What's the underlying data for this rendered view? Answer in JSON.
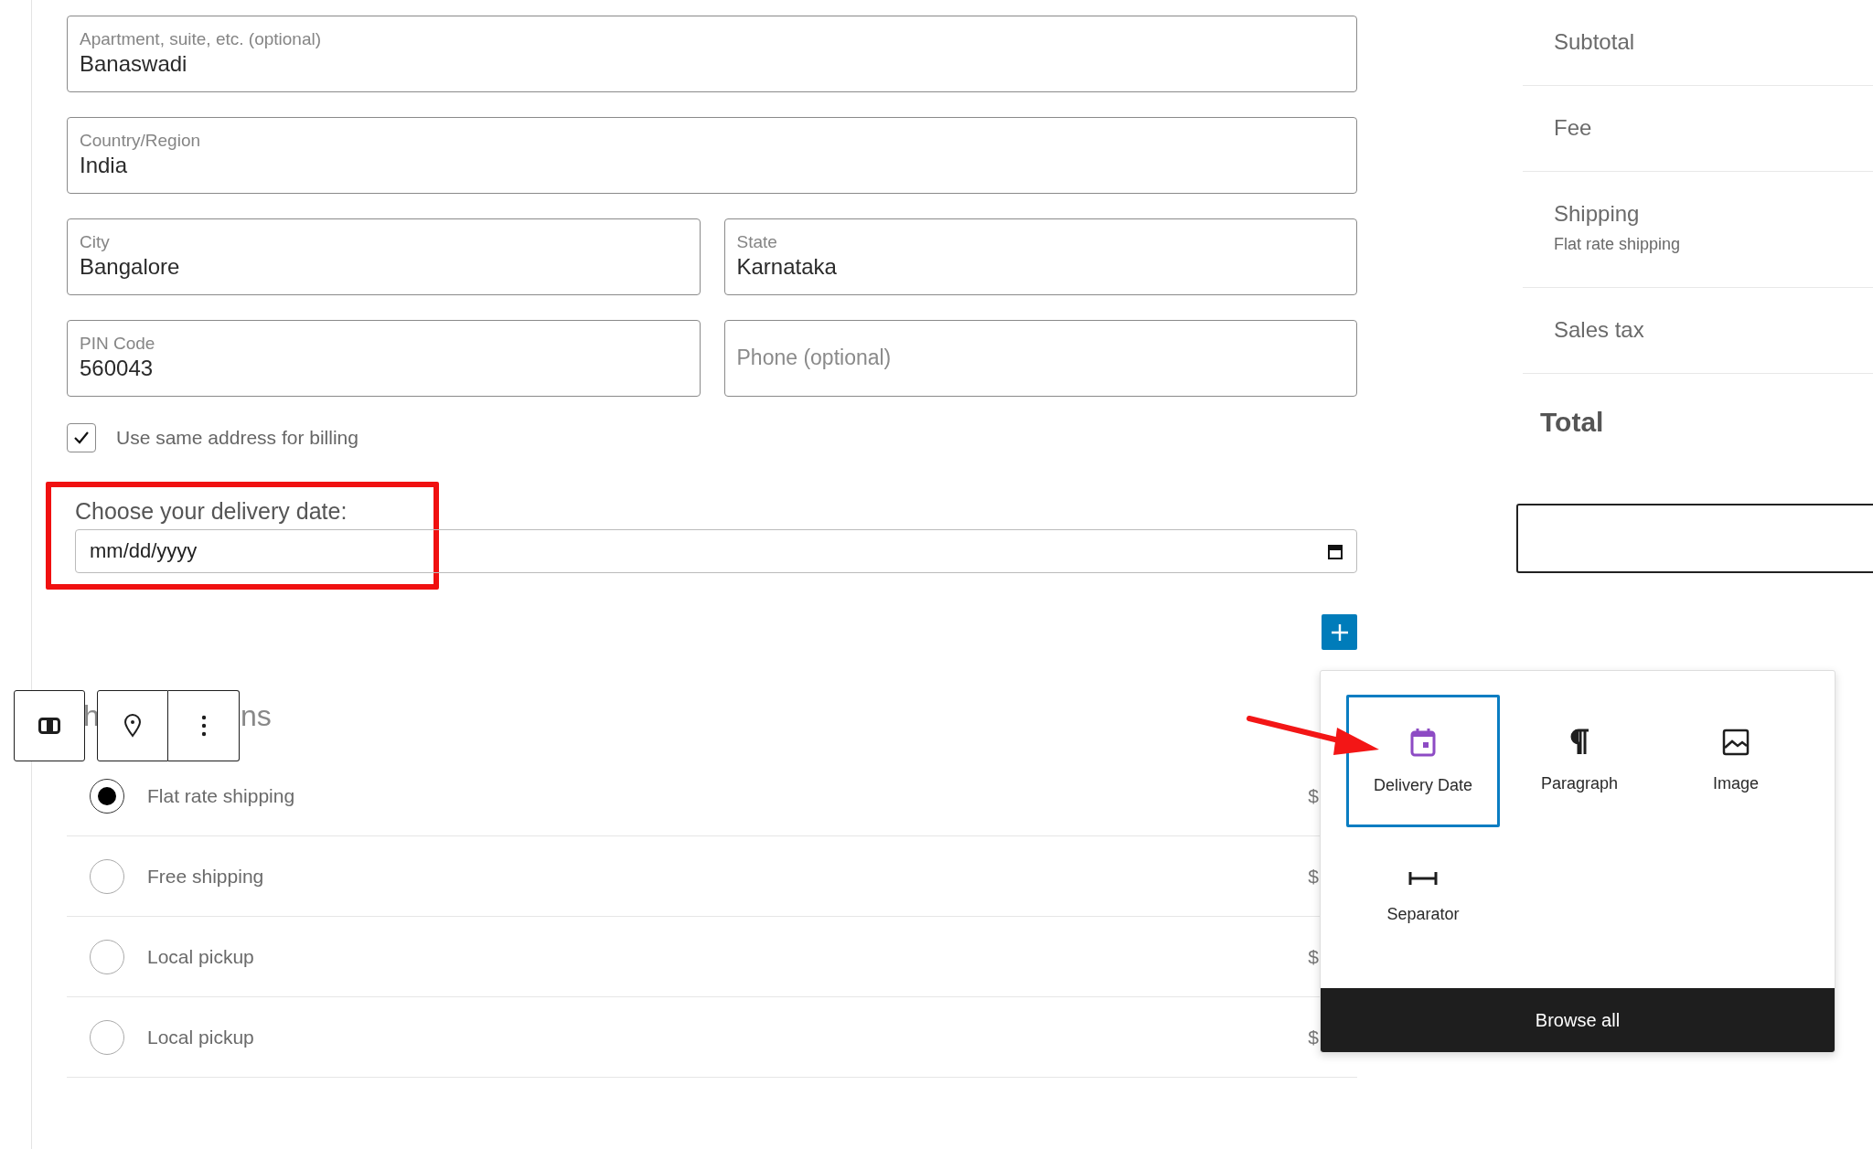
{
  "address_fields": [
    {
      "kind": "full",
      "label": "Apartment, suite, etc. (optional)",
      "value": "Banaswadi"
    },
    {
      "kind": "full",
      "label": "Country/Region",
      "value": "India"
    },
    {
      "kind": "half",
      "label": "City",
      "value": "Bangalore"
    },
    {
      "kind": "half",
      "label": "State",
      "value": "Karnataka"
    },
    {
      "kind": "half",
      "label": "PIN Code",
      "value": "560043"
    },
    {
      "kind": "half",
      "placeholder": "Phone (optional)"
    }
  ],
  "billing_checkbox": {
    "label": "Use same address for billing",
    "checked": true
  },
  "delivery_date": {
    "label": "Choose your delivery date:",
    "placeholder": "mm/dd/yyyy"
  },
  "shipping_heading_fragments": [
    "h",
    "ns"
  ],
  "shipping_options": [
    {
      "label": "Flat rate shipping",
      "selected": true,
      "price": "$"
    },
    {
      "label": "Free shipping",
      "selected": false,
      "price": "$"
    },
    {
      "label": "Local pickup",
      "selected": false,
      "price": "$"
    },
    {
      "label": "Local pickup",
      "selected": false,
      "price": "$"
    }
  ],
  "inserter": {
    "items": [
      {
        "label": "Delivery Date",
        "kind": "calendar",
        "selected": true
      },
      {
        "label": "Paragraph",
        "kind": "pilcrow",
        "selected": false
      },
      {
        "label": "Image",
        "kind": "image",
        "selected": false
      },
      {
        "label": "Separator",
        "kind": "separator",
        "selected": false
      }
    ],
    "footer": "Browse all"
  },
  "order_summary": {
    "rows": [
      {
        "label": "Subtotal"
      },
      {
        "label": "Fee"
      },
      {
        "label": "Shipping",
        "detail": "Flat rate shipping"
      },
      {
        "label": "Sales tax"
      }
    ],
    "total": "Total"
  }
}
